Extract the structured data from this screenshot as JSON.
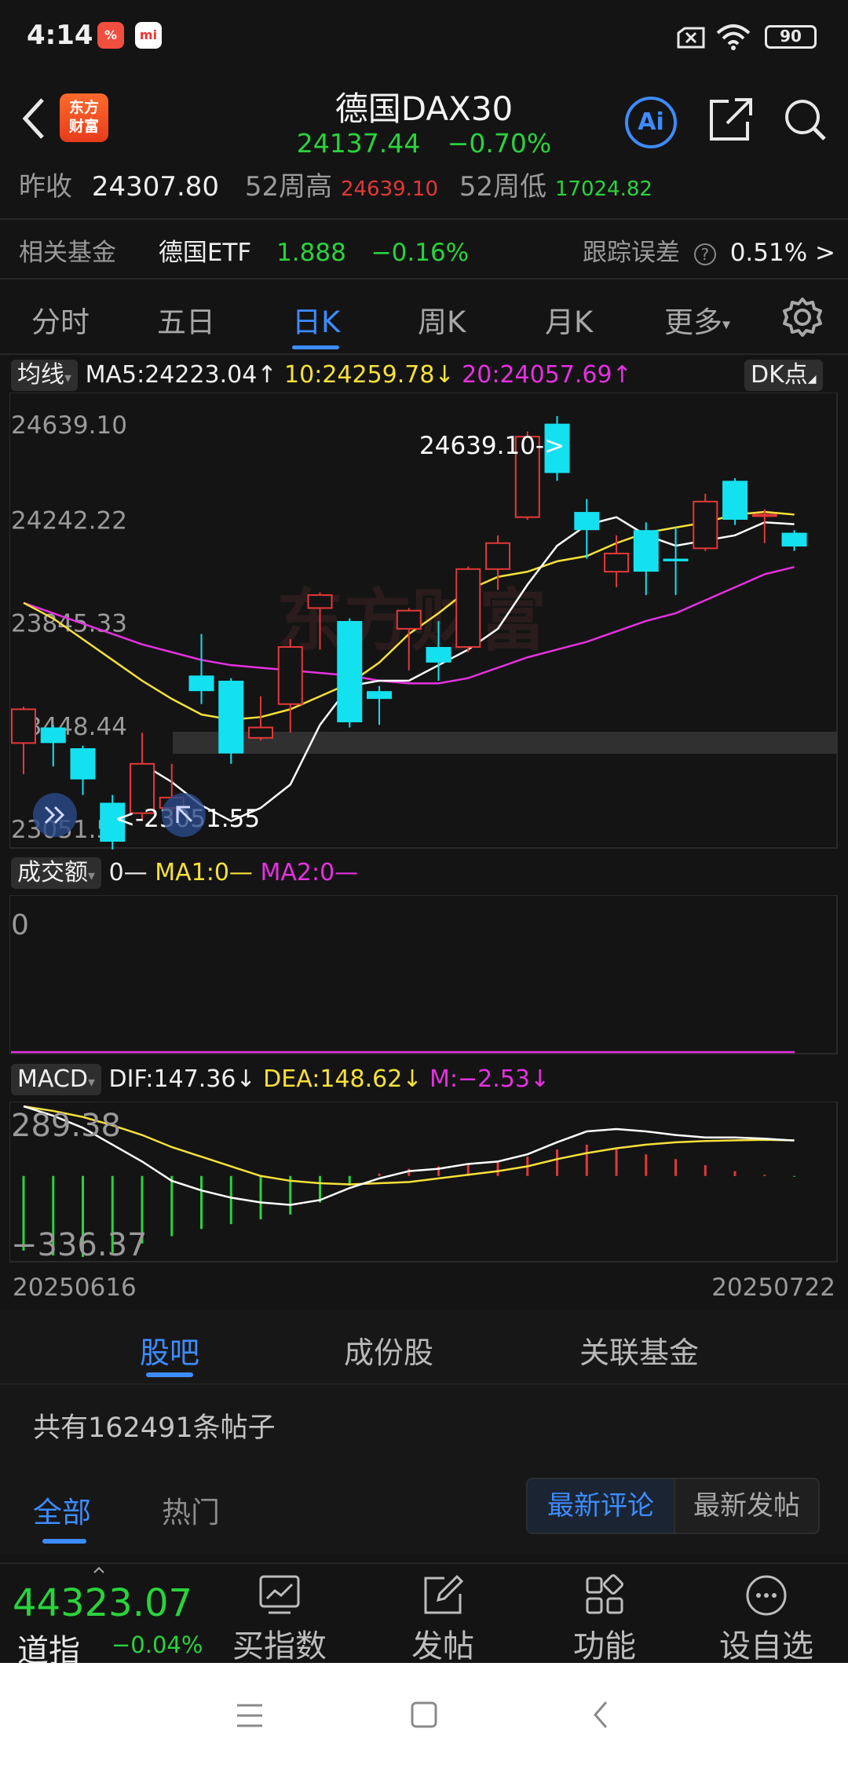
{
  "status": {
    "time": "4:14",
    "battery": "90",
    "app_icon_1": "%",
    "app_icon_2": "mi"
  },
  "header": {
    "title": "德国DAX30",
    "price": "24137.44",
    "change_pct": "−0.70%",
    "logo_line1": "东方",
    "logo_line2": "财富",
    "ai_label": "Ai"
  },
  "stats": {
    "prev_close_label": "昨收",
    "prev_close": "24307.80",
    "high52_label": "52周高",
    "high52": "24639.10",
    "low52_label": "52周低",
    "low52": "17024.82"
  },
  "fund": {
    "label": "相关基金",
    "name": "德国ETF",
    "price": "1.888",
    "change": "−0.16%",
    "tracking_label": "跟踪误差",
    "help_icon": "?",
    "tracking_value": "0.51% >"
  },
  "period_tabs": [
    "分时",
    "五日",
    "日K",
    "周K",
    "月K",
    "更多"
  ],
  "active_period": "日K",
  "ma": {
    "selector": "均线",
    "ma5": "MA5:24223.04",
    "ma10": "10:24259.78",
    "ma20": "20:24057.69",
    "dk_label": "DK点"
  },
  "kline": {
    "y_labels": [
      "24639.10",
      "24242.22",
      "23845.33",
      "23448.44",
      "23051.55"
    ],
    "high_marker": "24639.10->",
    "low_marker": "<-23051.55",
    "watermark": "东方财富"
  },
  "volume": {
    "selector": "成交额",
    "value0": "0—",
    "ma1": "MA1:0—",
    "ma2": "MA2:0—",
    "axis_zero": "0"
  },
  "macd": {
    "selector": "MACD",
    "dif": "DIF:147.36",
    "dea": "DEA:148.62",
    "m": "M:−2.53",
    "y_top": "289.38",
    "y_bottom": "−336.37"
  },
  "dates": {
    "start": "20250616",
    "end": "20250722"
  },
  "chart_data": {
    "type": "candlestick",
    "x": [
      "20250616",
      "20250722"
    ],
    "ylim": [
      23051.55,
      24639.1
    ],
    "candles": [
      {
        "o": 23380,
        "c": 23510,
        "h": 23520,
        "l": 23260
      },
      {
        "o": 23440,
        "c": 23380,
        "h": 23450,
        "l": 23290
      },
      {
        "o": 23360,
        "c": 23240,
        "h": 23370,
        "l": 23180
      },
      {
        "o": 23150,
        "c": 23000,
        "h": 23180,
        "l": 22950
      },
      {
        "o": 23110,
        "c": 23300,
        "h": 23420,
        "l": 23080
      },
      {
        "o": 23130,
        "c": 23170,
        "h": 23300,
        "l": 23060
      },
      {
        "o": 23640,
        "c": 23580,
        "h": 23800,
        "l": 23530
      },
      {
        "o": 23620,
        "c": 23340,
        "h": 23630,
        "l": 23300
      },
      {
        "o": 23400,
        "c": 23440,
        "h": 23560,
        "l": 23390
      },
      {
        "o": 23530,
        "c": 23750,
        "h": 23780,
        "l": 23420
      },
      {
        "o": 23900,
        "c": 23950,
        "h": 23960,
        "l": 23740
      },
      {
        "o": 23850,
        "c": 23460,
        "h": 23860,
        "l": 23440
      },
      {
        "o": 23580,
        "c": 23550,
        "h": 23600,
        "l": 23450
      },
      {
        "o": 23820,
        "c": 23890,
        "h": 23900,
        "l": 23660
      },
      {
        "o": 23750,
        "c": 23690,
        "h": 23850,
        "l": 23620
      },
      {
        "o": 23750,
        "c": 24050,
        "h": 24060,
        "l": 23730
      },
      {
        "o": 24050,
        "c": 24150,
        "h": 24180,
        "l": 23970
      },
      {
        "o": 24250,
        "c": 24560,
        "h": 24580,
        "l": 24240
      },
      {
        "o": 24610,
        "c": 24420,
        "h": 24639,
        "l": 24390
      },
      {
        "o": 24270,
        "c": 24200,
        "h": 24320,
        "l": 24090
      },
      {
        "o": 24040,
        "c": 24110,
        "h": 24180,
        "l": 23980
      },
      {
        "o": 24200,
        "c": 24040,
        "h": 24230,
        "l": 23950
      },
      {
        "o": 24090,
        "c": 24080,
        "h": 24210,
        "l": 23950
      },
      {
        "o": 24130,
        "c": 24310,
        "h": 24340,
        "l": 24120
      },
      {
        "o": 24390,
        "c": 24240,
        "h": 24400,
        "l": 24220
      },
      {
        "o": 24260,
        "c": 24260,
        "h": 24280,
        "l": 24150
      },
      {
        "o": 24190,
        "c": 24137,
        "h": 24200,
        "l": 24120
      }
    ],
    "ma5": [
      null,
      null,
      null,
      null,
      23300,
      23230,
      23140,
      23080,
      23130,
      23220,
      23450,
      23600,
      23620,
      23620,
      23680,
      23740,
      23820,
      23990,
      24140,
      24220,
      24250,
      24180,
      24140,
      24160,
      24180,
      24230,
      24223
    ],
    "ma10": [
      23920,
      23860,
      23780,
      23700,
      23620,
      23550,
      23490,
      23470,
      23480,
      23510,
      23560,
      23610,
      23690,
      23800,
      23880,
      23970,
      24020,
      24040,
      24080,
      24100,
      24150,
      24190,
      24210,
      24230,
      24260,
      24270,
      24260
    ],
    "ma20": [
      23920,
      23880,
      23840,
      23800,
      23760,
      23730,
      23700,
      23680,
      23670,
      23660,
      23650,
      23640,
      23620,
      23610,
      23610,
      23630,
      23670,
      23710,
      23740,
      23770,
      23810,
      23850,
      23880,
      23930,
      23980,
      24030,
      24058
    ],
    "macd_dif": [
      289,
      250,
      200,
      130,
      60,
      -20,
      -60,
      -90,
      -110,
      -120,
      -100,
      -50,
      -10,
      20,
      30,
      50,
      60,
      90,
      140,
      185,
      195,
      185,
      170,
      160,
      160,
      155,
      147
    ],
    "macd_dea": [
      289,
      270,
      245,
      210,
      170,
      120,
      80,
      40,
      0,
      -20,
      -30,
      -35,
      -30,
      -25,
      -10,
      5,
      20,
      40,
      70,
      95,
      115,
      130,
      140,
      145,
      148,
      150,
      148
    ],
    "macd_m": [
      -310,
      -330,
      -336,
      -320,
      -280,
      -250,
      -220,
      -200,
      -180,
      -160,
      -110,
      -40,
      10,
      30,
      40,
      50,
      60,
      80,
      110,
      130,
      110,
      90,
      70,
      45,
      20,
      5,
      -3
    ]
  },
  "bottom_tabs": [
    "股吧",
    "成份股",
    "关联基金"
  ],
  "post_count": "共有162491条帖子",
  "sub_tabs": [
    "全部",
    "热门"
  ],
  "sort": {
    "latest_comment": "最新评论",
    "latest_post": "最新发帖"
  },
  "toolbar": {
    "price": "44323.07",
    "name": "道指",
    "change": "−0.04%",
    "buy_index": "买指数",
    "post": "发帖",
    "functions": "功能",
    "watchlist": "设自选"
  },
  "colors": {
    "up": "#e33838",
    "down": "#14e1f0",
    "accent": "#3d8cff",
    "green": "#2ad33c"
  }
}
